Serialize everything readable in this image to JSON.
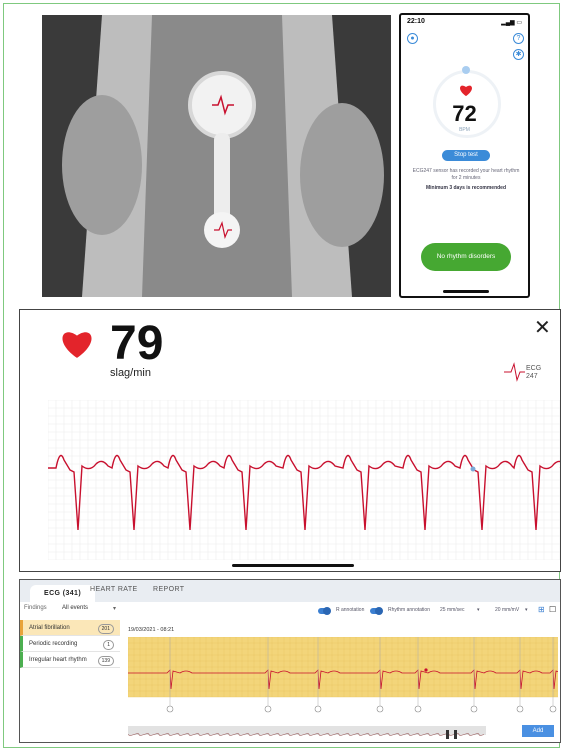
{
  "phone": {
    "time": "22:10",
    "bpm": "72",
    "bpm_unit": "BPM",
    "stop_button": "Stop test",
    "message": "ECG247 sensor has recorded your heart rhythm for 2 minutes",
    "minimum_note": "Minimum 3 days is recommended",
    "result_button": "No rhythm disorders",
    "help_icon_glyph": "?"
  },
  "monitor": {
    "heart_rate": "79",
    "unit": "slag/min",
    "close_glyph": "✕",
    "logo_text": "ECG",
    "logo_sub": "247"
  },
  "dashboard": {
    "tabs": [
      "ECG (341)",
      "HEART RATE",
      "REPORT"
    ],
    "findings_label": "Findings",
    "findings_value": "All events",
    "r_annotation": "R annotation",
    "rhythm_annotation": "Rhythm annotation",
    "speed": "25 mm/sec",
    "gain": "20 mm/mV",
    "findings": [
      {
        "label": "Atrial fibrillation",
        "count": "201",
        "color": "#e8a33a"
      },
      {
        "label": "Periodic recording",
        "count": "1",
        "color": "#4caf50"
      },
      {
        "label": "Irregular heart rhythm",
        "count": "139",
        "color": "#4caf50"
      }
    ],
    "date_label": "19/03/2021 - 08:21",
    "add_button": "Add"
  },
  "colors": {
    "accent_blue": "#3b8bd8",
    "success_green": "#46a832",
    "ecg_red": "#c8102e",
    "ecg_bg_yellow": "#f3d57a"
  }
}
